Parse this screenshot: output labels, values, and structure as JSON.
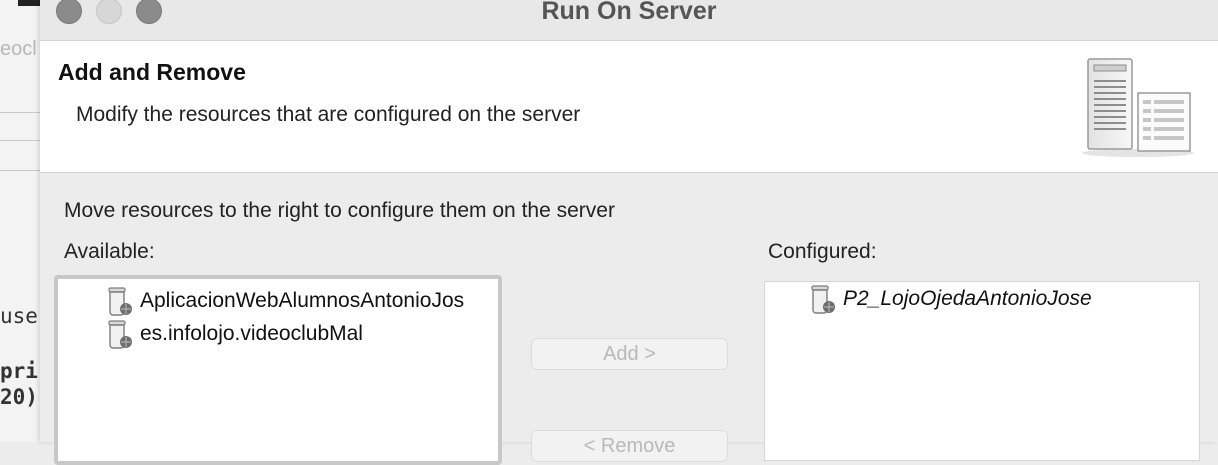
{
  "background_editor": {
    "tab_fragment": "eocl",
    "code_lines": [
      "use",
      "",
      "pri",
      "20)"
    ]
  },
  "window": {
    "title": "Run On Server"
  },
  "header": {
    "title": "Add and Remove",
    "description": "Modify the resources that are configured on the server"
  },
  "instructions": "Move resources to the right to configure them on the server",
  "available": {
    "label": "Available:",
    "items": [
      {
        "name": "AplicacionWebAlumnosAntonioJos"
      },
      {
        "name": "es.infolojo.videoclubMal"
      }
    ]
  },
  "configured": {
    "label": "Configured:",
    "items": [
      {
        "name": "P2_LojoOjedaAntonioJose"
      }
    ]
  },
  "buttons": {
    "add_label": "Add >",
    "remove_label": "< Remove"
  },
  "colors": {
    "traffic_light": "#8a8a8a",
    "disabled_text": "#b9b9b9",
    "header_bg": "#ffffff",
    "dialog_bg": "#ececec"
  }
}
